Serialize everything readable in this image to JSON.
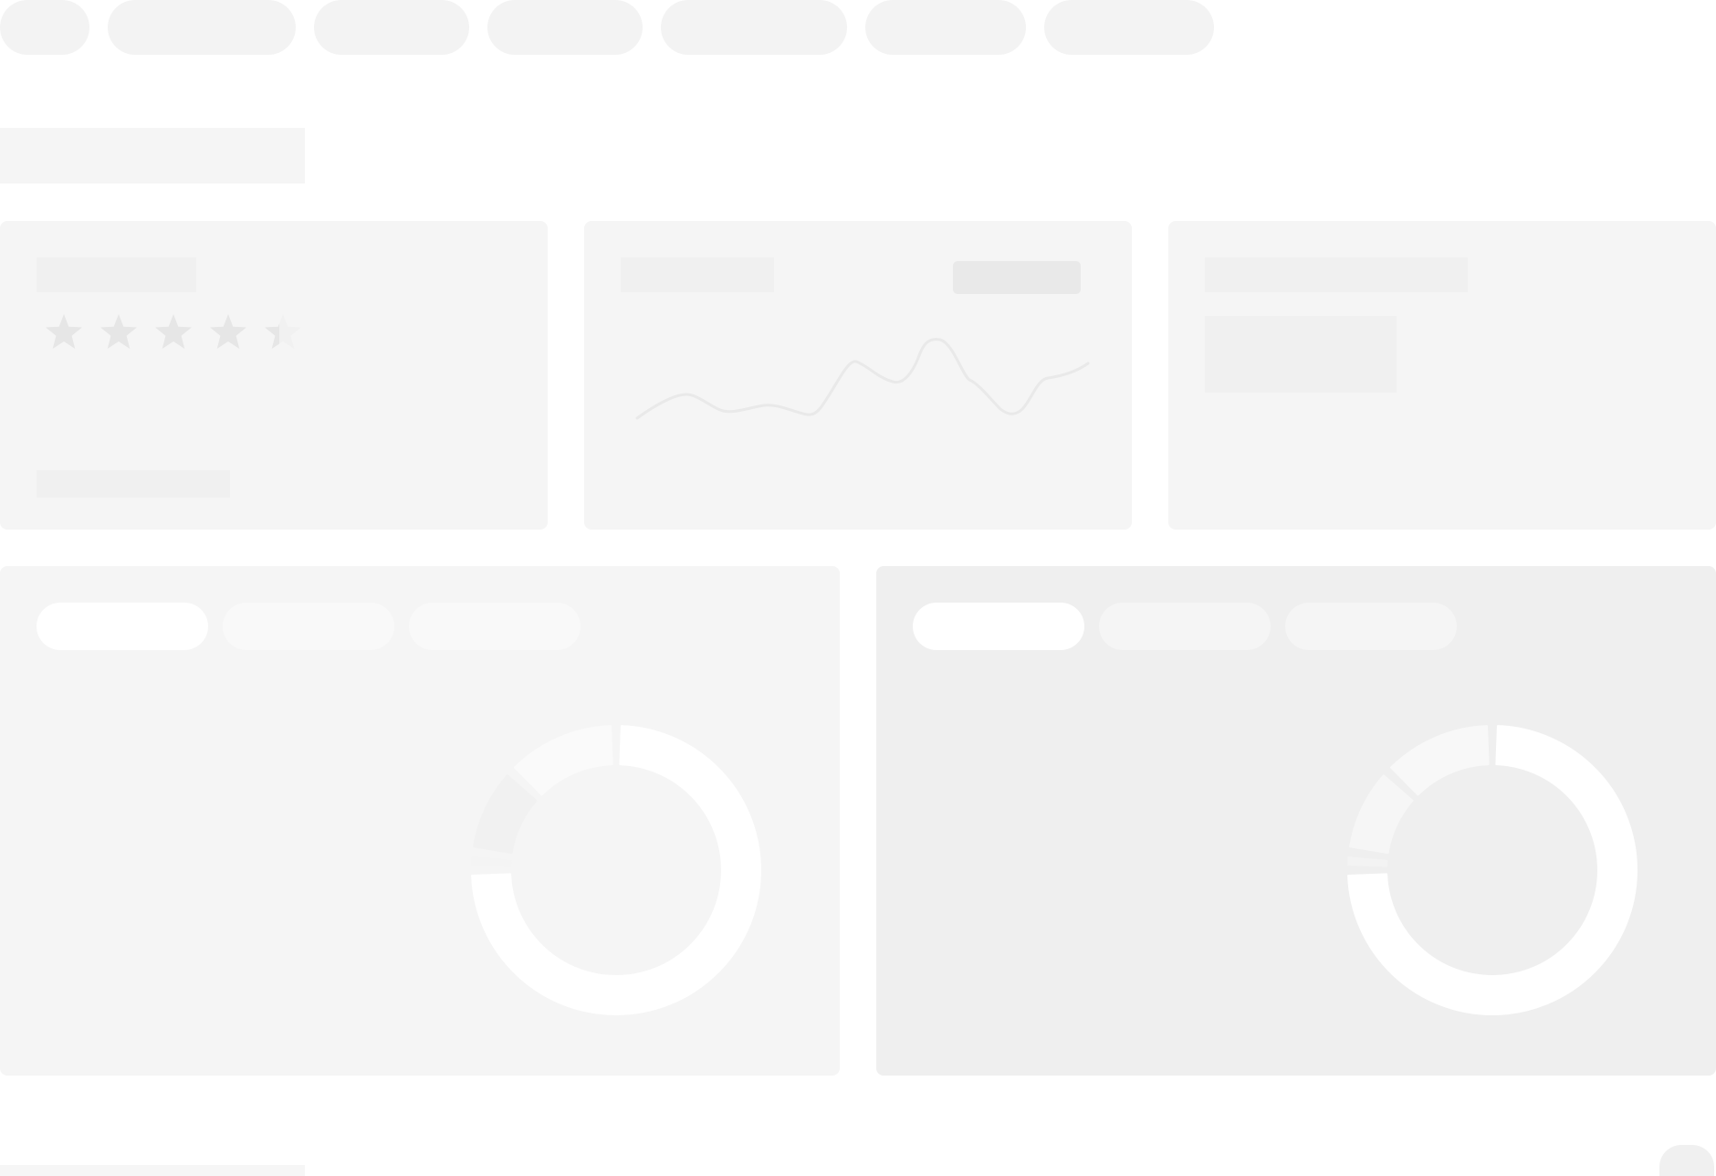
{
  "top_nav": {
    "tabs": [
      "",
      "",
      "",
      "",
      "",
      "",
      ""
    ]
  },
  "page_title": "",
  "rating_card": {
    "title": "",
    "rating": 4.4,
    "max_rating": 5,
    "footer": ""
  },
  "trend_card": {
    "title": "",
    "range_selector": ""
  },
  "summary_card": {
    "title": "",
    "value": ""
  },
  "left_panel": {
    "tabs": [
      "",
      "",
      ""
    ],
    "active_tab_index": 0,
    "donut": {
      "segments": [
        0.75,
        0.02,
        0.1,
        0.13
      ]
    }
  },
  "right_panel": {
    "tabs": [
      "",
      "",
      ""
    ],
    "active_tab_index": 0,
    "donut": {
      "segments": [
        0.75,
        0.02,
        0.1,
        0.13
      ]
    }
  },
  "bottom": {
    "label": "",
    "button": ""
  },
  "colors": {
    "skeleton": "#f3f3f3",
    "card": "#f5f5f5",
    "card_alt": "#efefef",
    "star_filled": "#e6e6e6",
    "star_empty": "#f1f1f1"
  }
}
